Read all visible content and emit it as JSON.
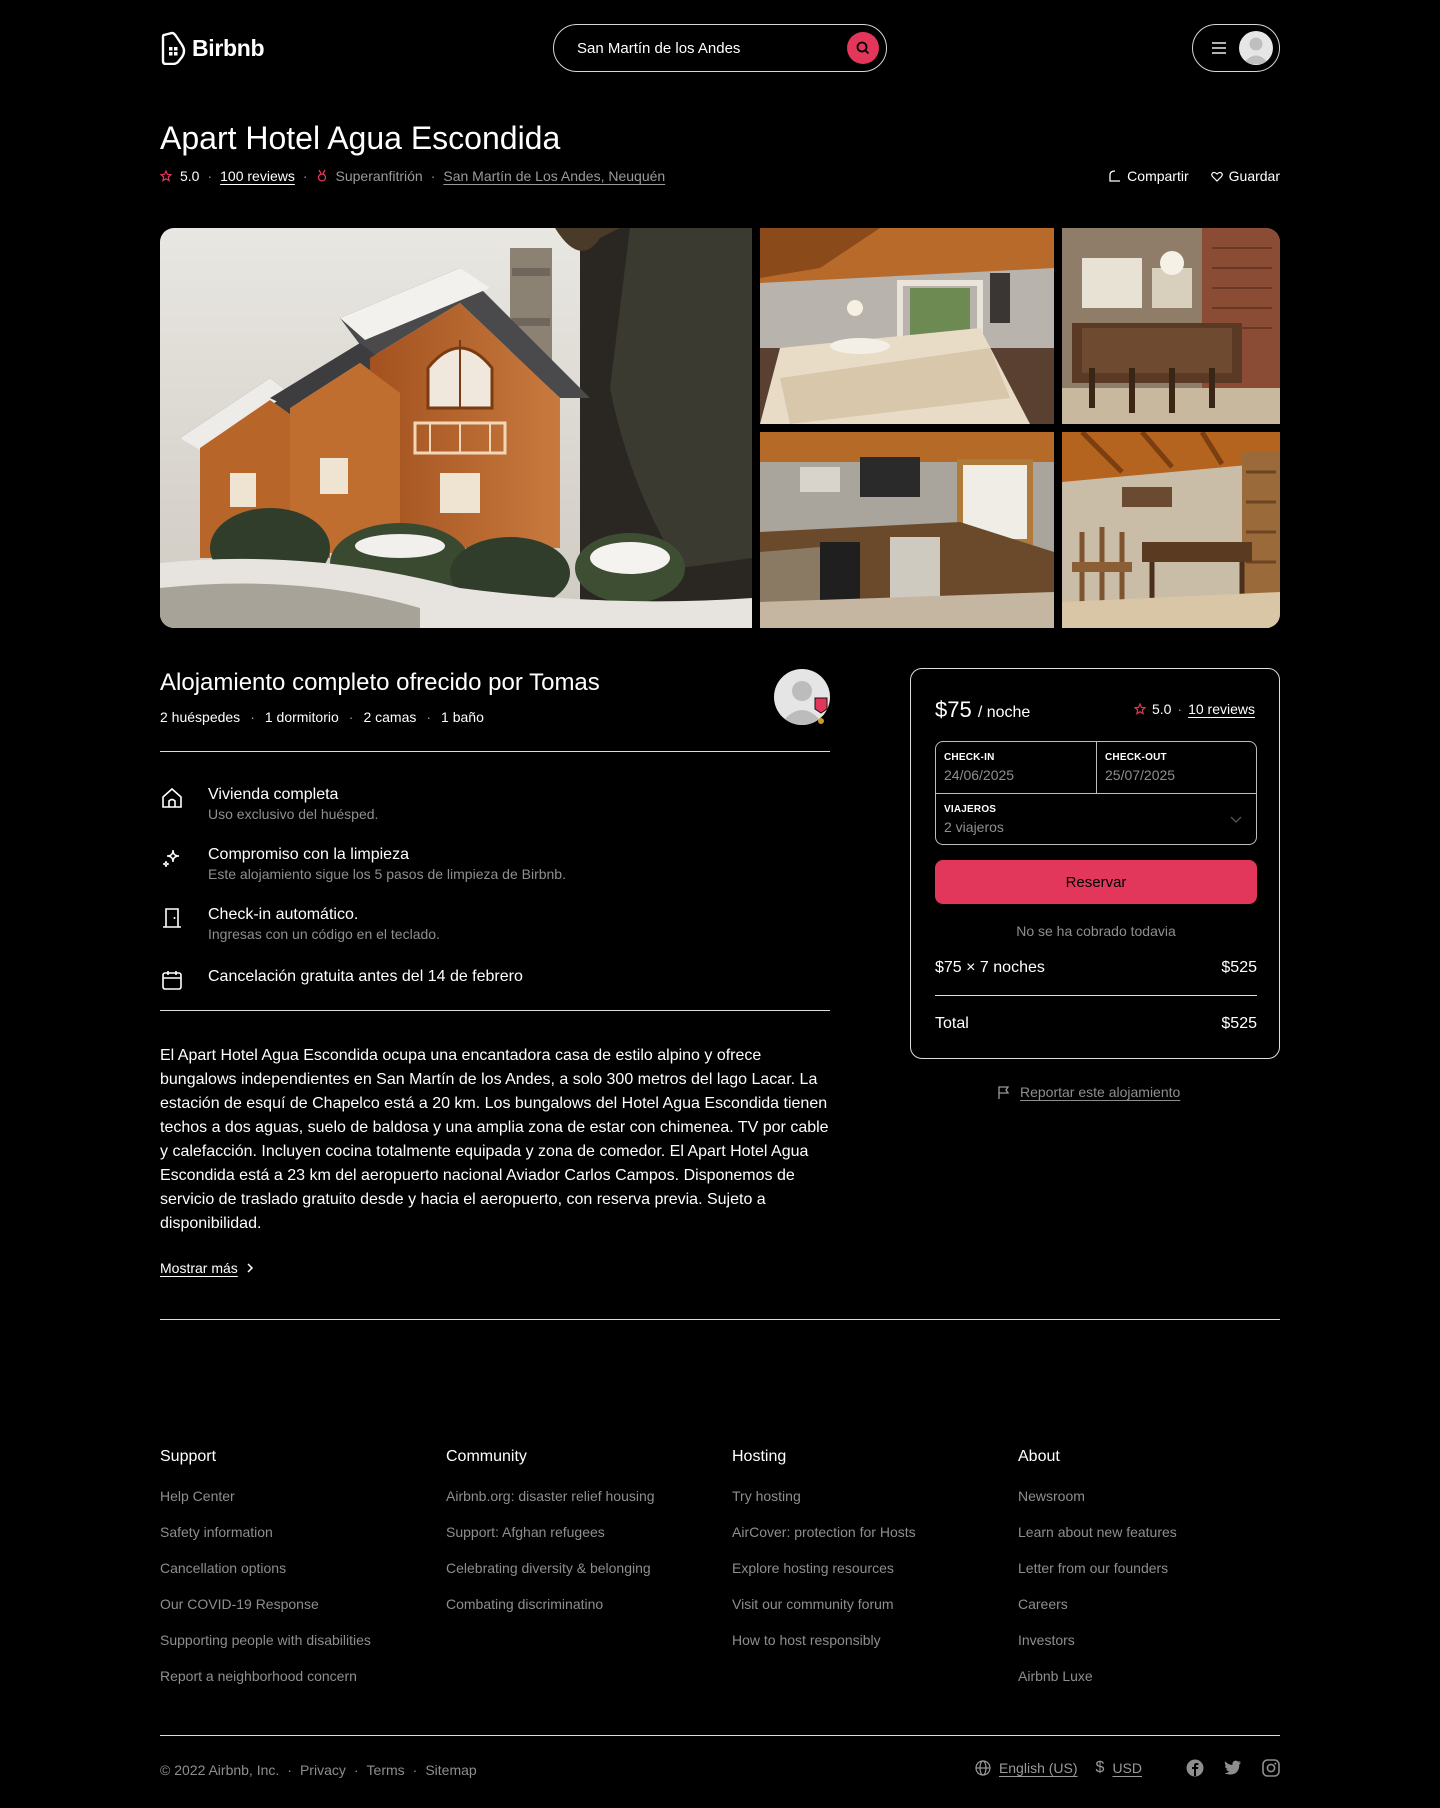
{
  "brand": {
    "name": "Birbnb",
    "accent": "#e2375a"
  },
  "search": {
    "value": "San Martín de los Andes"
  },
  "listing": {
    "title": "Apart Hotel Agua Escondida",
    "rating": "5.0",
    "reviews": "100 reviews",
    "superhost": "Superanfitrión",
    "location": "San Martín de Los Andes, Neuquén",
    "share": "Compartir",
    "save": "Guardar"
  },
  "host": {
    "title": "Alojamiento completo ofrecido por Tomas",
    "details": [
      "2 huéspedes",
      "1 dormitorio",
      "2 camas",
      "1 baño"
    ]
  },
  "features": [
    {
      "icon": "home-icon",
      "title": "Vivienda completa",
      "subtitle": "Uso exclusivo del huésped."
    },
    {
      "icon": "sparkles-icon",
      "title": "Compromiso con la limpieza",
      "subtitle": "Este alojamiento sigue los 5 pasos de limpieza de Birbnb."
    },
    {
      "icon": "door-icon",
      "title": "Check-in automático.",
      "subtitle": "Ingresas con un código en el teclado."
    },
    {
      "icon": "calendar-icon",
      "title": "Cancelación gratuita antes del 14 de febrero",
      "subtitle": ""
    }
  ],
  "description": "El Apart Hotel Agua Escondida ocupa una encantadora casa de estilo alpino y ofrece bungalows independientes en San Martín de los Andes, a solo 300 metros del lago Lacar. La estación de esquí de Chapelco está a 20 km.  Los bungalows del Hotel Agua Escondida tienen techos a dos aguas, suelo de baldosa y una amplia zona de estar con chimenea. TV por cable y calefacción. Incluyen cocina totalmente equipada y zona de comedor.  El Apart Hotel Agua Escondida está a 23 km del aeropuerto nacional Aviador Carlos Campos. Disponemos de servicio de traslado gratuito desde y hacia el aeropuerto, con reserva previa. Sujeto a disponibilidad.",
  "show_more": "Mostrar más",
  "booking": {
    "price": "$75",
    "per_night": "/ noche",
    "rating": "5.0",
    "reviews": "10 reviews",
    "checkin_label": "CHECK-IN",
    "checkin_value": "24/06/2025",
    "checkout_label": "CHECK-OUT",
    "checkout_value": "25/07/2025",
    "guests_label": "VIAJEROS",
    "guests_value": "2 viajeros",
    "reserve": "Reservar",
    "no_charge": "No se ha cobrado todavia",
    "line_label": "$75 × 7 noches",
    "line_amount": "$525",
    "total_label": "Total",
    "total_amount": "$525"
  },
  "report": "Reportar este alojamiento",
  "footer": {
    "columns": [
      {
        "title": "Support",
        "links": [
          "Help Center",
          "Safety information",
          "Cancellation options",
          "Our COVID-19 Response",
          "Supporting people with disabilities",
          "Report a neighborhood concern"
        ]
      },
      {
        "title": "Community",
        "links": [
          "Airbnb.org: disaster relief housing",
          "Support: Afghan refugees",
          "Celebrating diversity & belonging",
          "Combating discriminatino"
        ]
      },
      {
        "title": "Hosting",
        "links": [
          "Try hosting",
          "AirCover: protection for Hosts",
          "Explore hosting resources",
          "Visit our community forum",
          "How to host responsibly"
        ]
      },
      {
        "title": "About",
        "links": [
          "Newsroom",
          "Learn about new features",
          "Letter from our founders",
          "Careers",
          "Investors",
          "Airbnb Luxe"
        ]
      }
    ],
    "copyright": "© 2022 Airbnb, Inc.",
    "privacy": "Privacy",
    "terms": "Terms",
    "sitemap": "Sitemap",
    "language": "English (US)",
    "currency_symbol": "$",
    "currency": "USD"
  }
}
